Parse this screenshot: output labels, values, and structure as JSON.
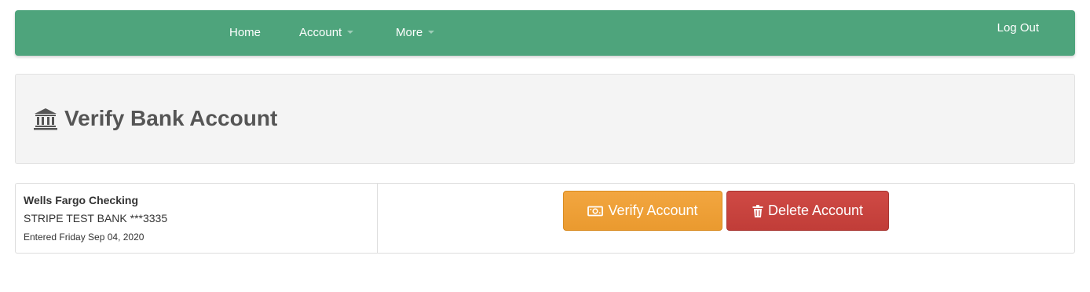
{
  "navbar": {
    "home_label": "Home",
    "account_label": "Account",
    "more_label": "More",
    "logout_label": "Log Out",
    "background_color": "#4ea47c"
  },
  "header": {
    "title": "Verify Bank Account",
    "icon": "bank-icon"
  },
  "account": {
    "name": "Wells Fargo Checking",
    "bank": "STRIPE TEST BANK ***3335",
    "entered": "Entered Friday Sep 04, 2020"
  },
  "actions": {
    "verify_label": "Verify Account",
    "verify_icon": "money-icon",
    "verify_color": "#f0a33a",
    "delete_label": "Delete Account",
    "delete_icon": "trash-icon",
    "delete_color": "#c9443f"
  }
}
